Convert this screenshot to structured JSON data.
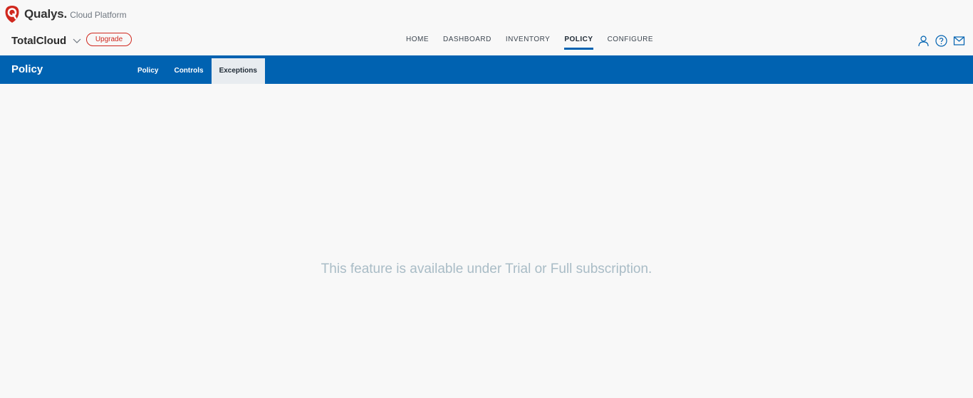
{
  "brand": {
    "name": "Qualys",
    "dot": ".",
    "subtitle": "Cloud Platform",
    "color": "#d0281e"
  },
  "app": {
    "name": "TotalCloud",
    "upgrade_label": "Upgrade"
  },
  "nav": {
    "items": [
      {
        "label": "HOME",
        "active": false
      },
      {
        "label": "DASHBOARD",
        "active": false
      },
      {
        "label": "INVENTORY",
        "active": false
      },
      {
        "label": "POLICY",
        "active": true
      },
      {
        "label": "CONFIGURE",
        "active": false
      }
    ]
  },
  "utility_icons": [
    "user-icon",
    "help-icon",
    "mail-icon"
  ],
  "module": {
    "title": "Policy",
    "tabs": [
      {
        "label": "Policy",
        "active": false
      },
      {
        "label": "Controls",
        "active": false
      },
      {
        "label": "Exceptions",
        "active": true
      }
    ]
  },
  "content": {
    "message": "This feature is available under Trial or Full subscription."
  },
  "colors": {
    "accent": "#0062b1",
    "upgrade": "#d0281e",
    "message": "#a9bcc6",
    "background": "#f8f8f8"
  }
}
